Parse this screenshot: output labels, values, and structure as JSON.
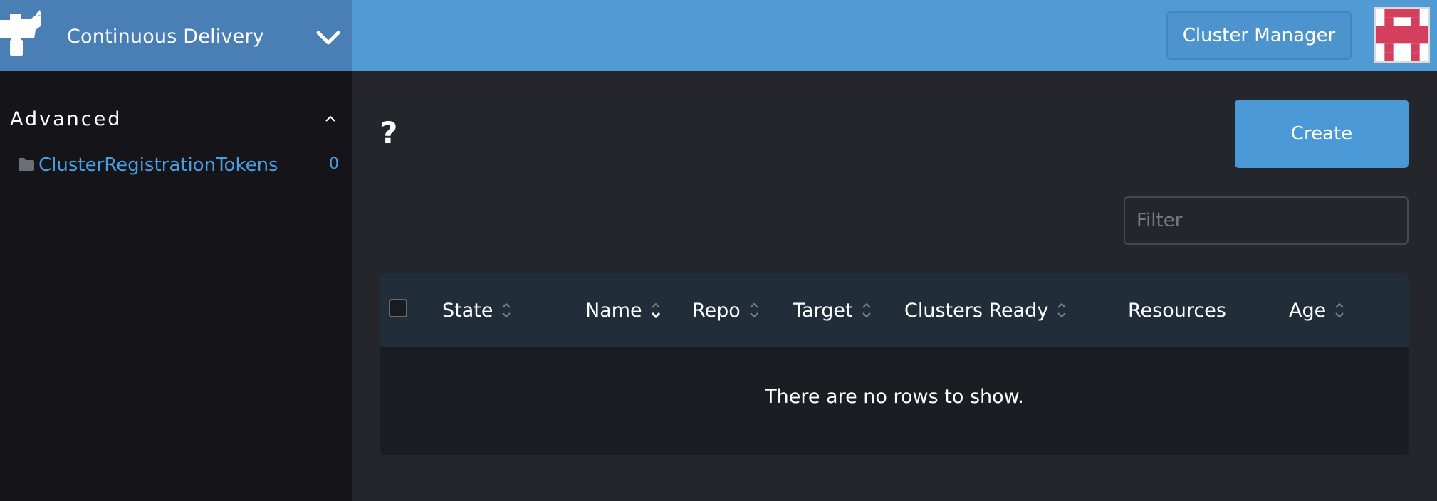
{
  "app": {
    "title": "Continuous Delivery",
    "brand_icon": "rancher-bull-icon",
    "colors": {
      "topbar": "#519bd4",
      "brand": "#4a7fb6",
      "link": "#4a9ee0",
      "sidebar": "#141419",
      "main": "#25262b"
    }
  },
  "sidebar": {
    "group_title": "Advanced",
    "items": [
      {
        "label": "ClusterRegistrationTokens",
        "count": "0",
        "icon": "folder-icon"
      }
    ]
  },
  "topbar": {
    "cluster_manager_label": "Cluster Manager"
  },
  "main": {
    "page_title": "?",
    "create_label": "Create",
    "filter_placeholder": "Filter",
    "table": {
      "columns": [
        "State",
        "Name",
        "Repo",
        "Target",
        "Clusters Ready",
        "Resources",
        "Age"
      ],
      "empty_message": "There are no rows to show."
    }
  }
}
